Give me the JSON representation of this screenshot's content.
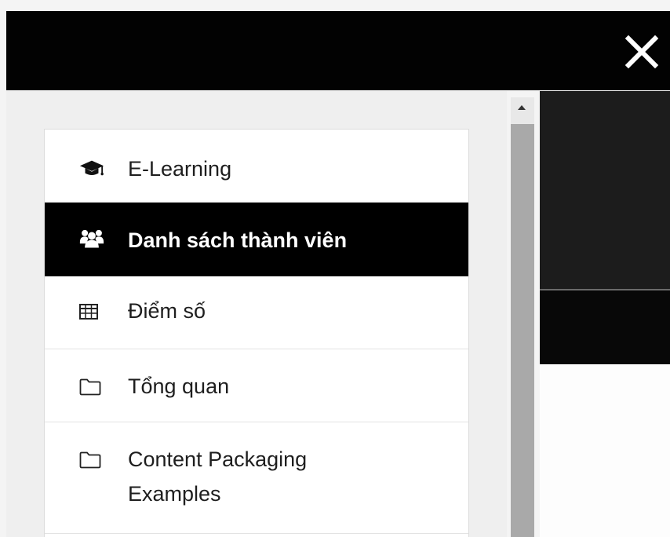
{
  "header": {
    "close_icon": "close-icon",
    "background_color": "#020202",
    "close_color": "#ffffff"
  },
  "nav": {
    "items": [
      {
        "label": "E-Learning",
        "icon": "graduation-cap-icon",
        "active": false
      },
      {
        "label": "Danh sách thành viên",
        "icon": "users-icon",
        "active": true
      },
      {
        "label": "Điểm số",
        "icon": "table-icon",
        "active": false
      },
      {
        "label": "Tổng quan",
        "icon": "folder-icon",
        "active": false
      },
      {
        "label_line1": "Content Packaging",
        "label_line2": "Examples",
        "icon": "folder-icon",
        "active": false
      }
    ],
    "active_background": "#000000",
    "active_text_color": "#ffffff"
  },
  "scrollbar": {
    "up_arrow_icon": "scroll-up-arrow-icon"
  }
}
